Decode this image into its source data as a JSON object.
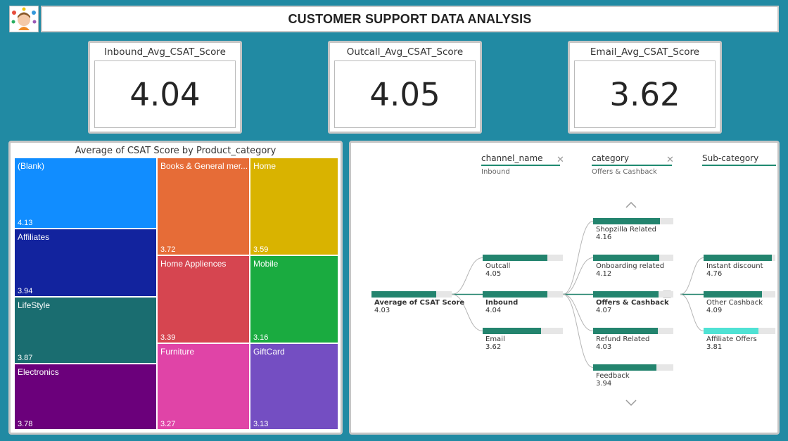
{
  "header": {
    "title": "CUSTOMER SUPPORT DATA ANALYSIS",
    "logo_icon": "support-agent-avatar-icon"
  },
  "kpis": [
    {
      "label": "Inbound_Avg_CSAT_Score",
      "value": "4.04"
    },
    {
      "label": "Outcall_Avg_CSAT_Score",
      "value": "4.05"
    },
    {
      "label": "Email_Avg_CSAT_Score",
      "value": "3.62"
    }
  ],
  "chart_data": [
    {
      "type": "treemap",
      "title": "Average of CSAT Score by Product_category",
      "items": [
        {
          "name": "(Blank)",
          "value": "4.13",
          "color": "#118dff"
        },
        {
          "name": "Affiliates",
          "value": "3.94",
          "color": "#12239e"
        },
        {
          "name": "LifeStyle",
          "value": "3.87",
          "color": "#1a6d70"
        },
        {
          "name": "Electronics",
          "value": "3.78",
          "color": "#6b007b"
        },
        {
          "name": "Books & General merchandise",
          "display_name": "Books & General mer...",
          "value": "3.72",
          "color": "#e66c37"
        },
        {
          "name": "Home Appliences",
          "value": "3.39",
          "color": "#d64550"
        },
        {
          "name": "Furniture",
          "value": "3.27",
          "color": "#e044a7"
        },
        {
          "name": "Home",
          "value": "3.59",
          "color": "#d9b300"
        },
        {
          "name": "Mobile",
          "value": "3.16",
          "color": "#1aab40"
        },
        {
          "name": "GiftCard",
          "value": "3.13",
          "color": "#744ec2"
        }
      ]
    },
    {
      "type": "decomposition_tree",
      "value_scale_max": 5,
      "fill_color": "#23846e",
      "highlight_color": "#4fe2d4",
      "levels": [
        {
          "header": "channel_name",
          "filter": "Inbound"
        },
        {
          "header": "category",
          "filter": "Offers & Cashback"
        },
        {
          "header": "Sub-category",
          "filter": ""
        }
      ],
      "root": {
        "label": "Average of CSAT Score",
        "value": "4.03"
      },
      "channel_nodes": [
        {
          "label": "Outcall",
          "value": "4.05"
        },
        {
          "label": "Inbound",
          "value": "4.04",
          "selected": true
        },
        {
          "label": "Email",
          "value": "3.62"
        }
      ],
      "category_nodes": [
        {
          "label": "Shopzilla Related",
          "value": "4.16"
        },
        {
          "label": "Onboarding related",
          "value": "4.12"
        },
        {
          "label": "Offers & Cashback",
          "value": "4.07",
          "selected": true
        },
        {
          "label": "Refund Related",
          "value": "4.03"
        },
        {
          "label": "Feedback",
          "value": "3.94"
        }
      ],
      "subcategory_nodes": [
        {
          "label": "Instant discount",
          "value": "4.76"
        },
        {
          "label": "Other Cashback",
          "value": "4.09"
        },
        {
          "label": "Affiliate Offers",
          "value": "3.81",
          "highlight": true
        }
      ]
    }
  ]
}
